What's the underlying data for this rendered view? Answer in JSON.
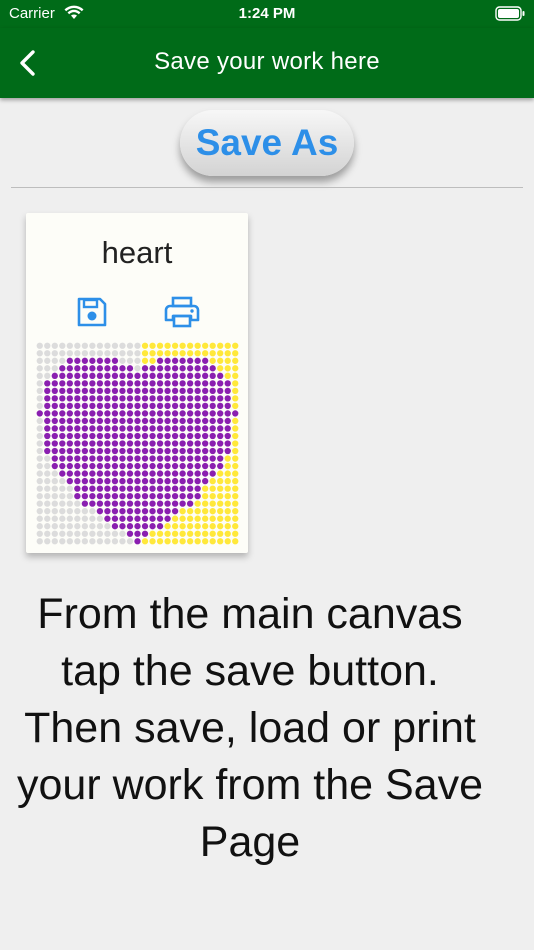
{
  "status": {
    "carrier": "Carrier",
    "time": "1:24 PM"
  },
  "nav": {
    "title": "Save your work here"
  },
  "save_as_label": "Save As",
  "saved_item": {
    "name": "heart",
    "grid_size": 27,
    "colors": {
      "fill": "#8a1fb0",
      "background_left": "#dcdcdc",
      "background_right": "#ffe83a"
    }
  },
  "instructions": "From the main canvas tap the save button. Then save, load or print your work from the Save Page",
  "colors": {
    "nav_green": "#006b18",
    "accent_blue": "#2d8fe8"
  },
  "icons": [
    "back-chevron-icon",
    "save-floppy-icon",
    "printer-icon",
    "wifi-icon",
    "battery-icon"
  ]
}
